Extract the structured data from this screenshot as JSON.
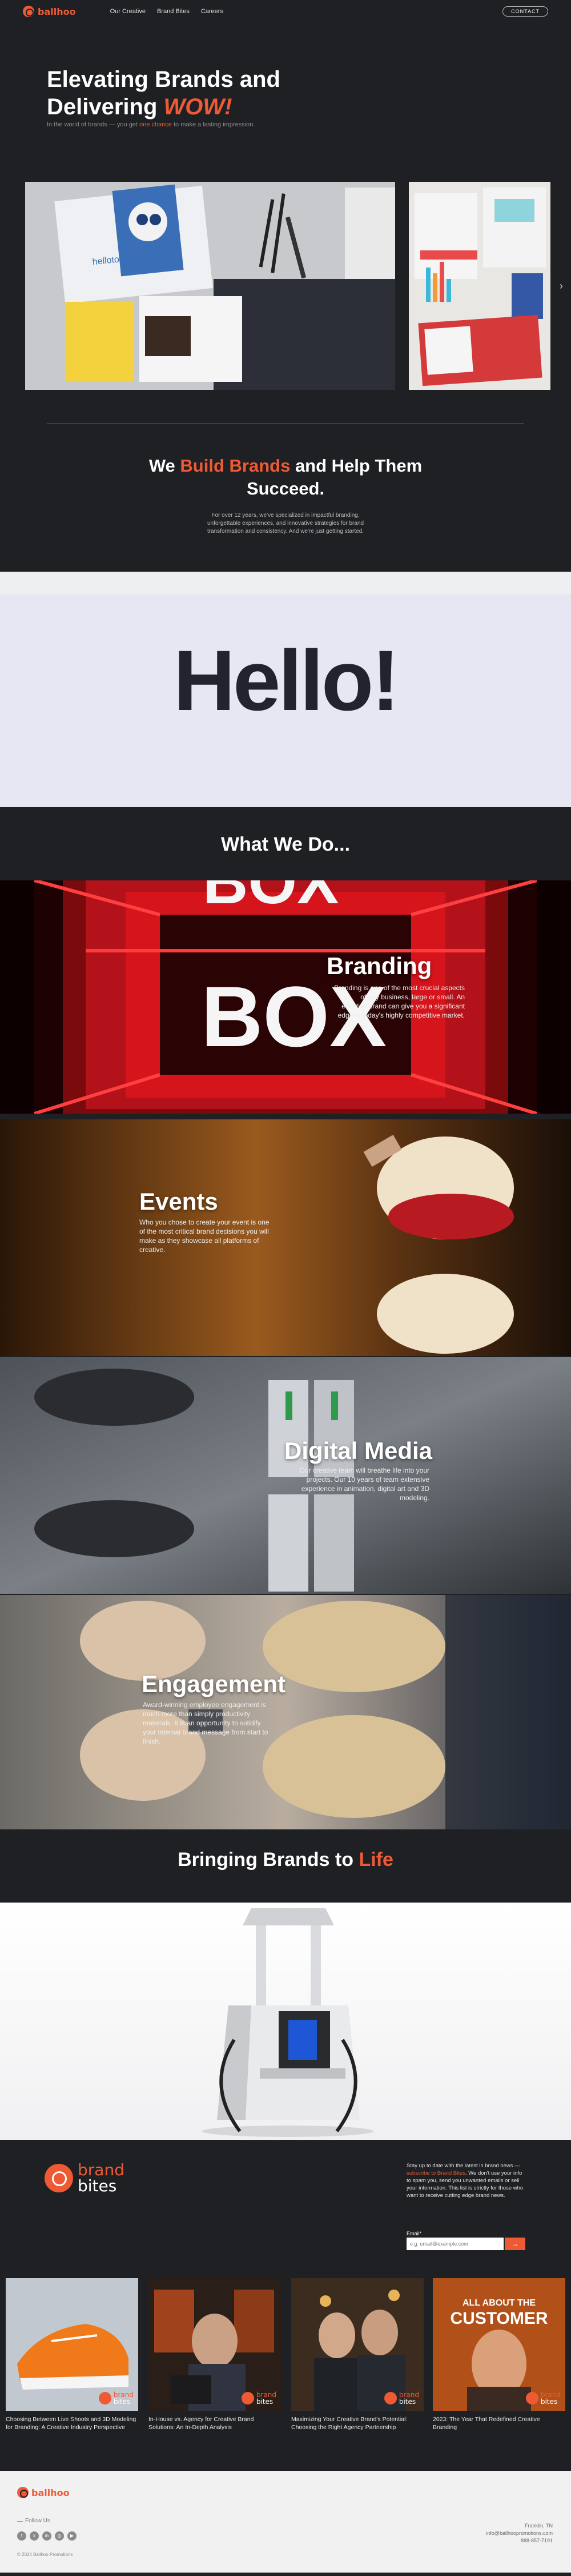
{
  "nav": {
    "logo_text": "ballhoo",
    "links": [
      "Our Creative",
      "Brand Bites",
      "Careers"
    ],
    "contact_label": "CONTACT"
  },
  "hero": {
    "title_line1": "Elevating Brands and",
    "title_line2": "Delivering ",
    "title_wow": "WOW!",
    "subtitle_pre": "In the world of brands — you get ",
    "subtitle_highlight": "one chance",
    "subtitle_post": " to make a lasting impression."
  },
  "slider": {
    "slide1_caption": "hellotomorrow",
    "arrow": "›"
  },
  "intro": {
    "title_pre": "We ",
    "title_highlight": "Build Brands",
    "title_post": " and Help Them Succeed.",
    "text": "For over 12 years, we've specialized in impactful branding, unforgettable experiences, and innovative strategies for brand transformation and consistency. And we're just getting started."
  },
  "hello": {
    "text": "Hello!"
  },
  "services": {
    "heading": "What We Do...",
    "items": [
      {
        "title": "Branding",
        "text": "Branding is one of the most crucial aspects of any business, large or small. An effective brand can give you a significant edge in today's highly competitive market.",
        "sign": "BOX"
      },
      {
        "title": "Events",
        "text": "Who you chose to create your event is one of the most critical brand decisions you will make as they showcase all platforms of creative."
      },
      {
        "title": "Digital Media",
        "text": "Our creative team will breathe life into your projects. Our 10 years of team extensive experience in animation, digital art and 3D modeling."
      },
      {
        "title": "Engagement",
        "text": "Award-winning employee engagement is much more than simply productivity materials. It is an opportunity to solidify your internal brand message from start to finish."
      }
    ]
  },
  "life": {
    "title_pre": "Bringing Brands to ",
    "title_highlight": "Life"
  },
  "brand_bites": {
    "word1": "brand",
    "word2": "bites",
    "desc_pre": "Stay up to date with the latest in brand news — ",
    "desc_highlight": "subscribe to Brand Bites",
    "desc_post": ". We don't use your info to spam you, send you unwanted emails or sell your information. This list is strictly for those who want to receive cutting edge brand news.",
    "email_label": "Email*",
    "email_placeholder": "e.g. email@example.com",
    "submit_icon": "→",
    "cards": [
      {
        "caption": "Choosing Between Live Shoots and 3D Modeling for Branding: A Creative Industry Perspective"
      },
      {
        "caption": "In-House vs. Agency for Creative Brand Solutions: An In-Depth Analysis"
      },
      {
        "caption": "Maximizing Your Creative Brand's Potential: Choosing the Right Agency Partnership"
      },
      {
        "caption": "2023: The Year That Redefined Creative Branding",
        "overlay_top": "ALL ABOUT THE",
        "overlay_main": "CUSTOMER"
      }
    ]
  },
  "footer": {
    "logo_text": "ballhoo",
    "follow_label": "Follow Us",
    "socials": [
      "f",
      "x",
      "in",
      "◎",
      "▶"
    ],
    "copyright": "© 2024 Ballhoo Promotions",
    "contact": [
      "Franklin, TN",
      "info@ballhoopromotions.com",
      "888-857-7191"
    ]
  },
  "colors": {
    "accent": "#ef5a35",
    "dark": "#1f2023",
    "hello_bg": "#e6e7f2"
  }
}
